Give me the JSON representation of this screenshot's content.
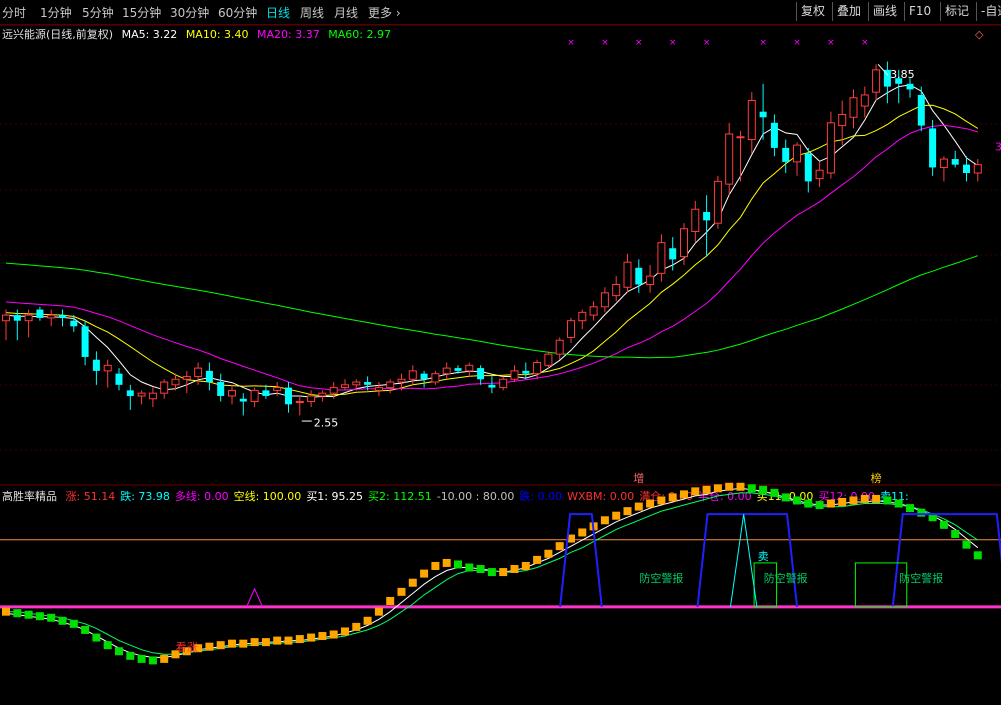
{
  "toolbar": {
    "periods": [
      "分时",
      "1分钟",
      "5分钟",
      "15分钟",
      "30分钟",
      "60分钟",
      "日线",
      "周线",
      "月线",
      "更多"
    ],
    "active_period": "日线",
    "more_arrow": "›",
    "right_buttons": [
      "复权",
      "叠加",
      "画线",
      "F10",
      "标记",
      "-自选"
    ]
  },
  "main_legend": {
    "stock_name": "远兴能源(日线,前复权)",
    "items": [
      {
        "label": "MA5: 3.22",
        "color": "#ffffff"
      },
      {
        "label": "MA10: 3.40",
        "color": "#ffff00"
      },
      {
        "label": "MA20: 3.37",
        "color": "#ff00ff"
      },
      {
        "label": "MA60: 2.97",
        "color": "#00ff00"
      }
    ]
  },
  "indicator_legend": {
    "name": "高胜率精品",
    "items": [
      {
        "label": "涨: 51.14",
        "color": "#ff3030"
      },
      {
        "label": "跌: 73.98",
        "color": "#00ffff"
      },
      {
        "label": "多线: 0.00",
        "color": "#ff00ff"
      },
      {
        "label": "空线: 100.00",
        "color": "#ffff00"
      },
      {
        "label": "买1: 95.25",
        "color": "#ffffff"
      },
      {
        "label": "买2: 112.51",
        "color": "#00ff00"
      },
      {
        "label": "-10.00 : 80.00",
        "color": "#c0c0c0"
      },
      {
        "label": "跌: 0.00",
        "color": "#0000ff"
      },
      {
        "label": "WXBM: 0.00",
        "color": "#ff3030"
      },
      {
        "label": "满仓: 0.00",
        "color": "#ff3030"
      },
      {
        "label": "半仓: 0.00",
        "color": "#ff00ff"
      },
      {
        "label": "买11: 0.00",
        "color": "#ffff00"
      },
      {
        "label": "买12: 0.00",
        "color": "#ff00ff"
      },
      {
        "label": "卖11:",
        "color": "#00ffff"
      }
    ]
  },
  "annotations": {
    "high_label": "3.85",
    "low_label": "2.55",
    "right_edge_label": "3",
    "top_marker": "◇",
    "marker_zeng": "增",
    "marker_bang": "榜",
    "signal_kanzhang": "看涨",
    "signal_fangkong": "防空警报",
    "signal_mai": "卖"
  },
  "chart_data": [
    {
      "type": "candlestick",
      "title": "远兴能源(日线,前复权)",
      "ylim": [
        2.4,
        3.95
      ],
      "candles": [
        [
          2.95,
          2.99,
          2.88,
          2.97
        ],
        [
          2.97,
          2.99,
          2.88,
          2.95
        ],
        [
          2.95,
          2.99,
          2.89,
          2.97
        ],
        [
          2.99,
          3.0,
          2.95,
          2.96
        ],
        [
          2.96,
          2.99,
          2.93,
          2.97
        ],
        [
          2.97,
          2.99,
          2.93,
          2.96
        ],
        [
          2.95,
          2.97,
          2.91,
          2.93
        ],
        [
          2.93,
          2.95,
          2.79,
          2.82
        ],
        [
          2.81,
          2.84,
          2.72,
          2.77
        ],
        [
          2.77,
          2.81,
          2.71,
          2.79
        ],
        [
          2.76,
          2.78,
          2.7,
          2.72
        ],
        [
          2.7,
          2.72,
          2.63,
          2.68
        ],
        [
          2.68,
          2.7,
          2.65,
          2.69
        ],
        [
          2.67,
          2.71,
          2.64,
          2.69
        ],
        [
          2.69,
          2.74,
          2.67,
          2.73
        ],
        [
          2.72,
          2.76,
          2.7,
          2.74
        ],
        [
          2.74,
          2.77,
          2.69,
          2.75
        ],
        [
          2.75,
          2.8,
          2.72,
          2.78
        ],
        [
          2.77,
          2.8,
          2.7,
          2.73
        ],
        [
          2.73,
          2.76,
          2.66,
          2.68
        ],
        [
          2.68,
          2.72,
          2.65,
          2.7
        ],
        [
          2.67,
          2.69,
          2.61,
          2.66
        ],
        [
          2.66,
          2.71,
          2.64,
          2.7
        ],
        [
          2.7,
          2.72,
          2.67,
          2.68
        ],
        [
          2.7,
          2.73,
          2.68,
          2.71
        ],
        [
          2.71,
          2.73,
          2.62,
          2.65
        ],
        [
          2.66,
          2.68,
          2.61,
          2.66
        ],
        [
          2.66,
          2.7,
          2.64,
          2.68
        ],
        [
          2.68,
          2.7,
          2.66,
          2.69
        ],
        [
          2.69,
          2.73,
          2.67,
          2.71
        ],
        [
          2.71,
          2.74,
          2.7,
          2.72
        ],
        [
          2.72,
          2.74,
          2.7,
          2.73
        ],
        [
          2.73,
          2.75,
          2.7,
          2.72
        ],
        [
          2.7,
          2.73,
          2.68,
          2.71
        ],
        [
          2.71,
          2.74,
          2.69,
          2.73
        ],
        [
          2.73,
          2.76,
          2.7,
          2.74
        ],
        [
          2.74,
          2.79,
          2.72,
          2.77
        ],
        [
          2.76,
          2.77,
          2.71,
          2.74
        ],
        [
          2.73,
          2.77,
          2.72,
          2.76
        ],
        [
          2.76,
          2.8,
          2.74,
          2.78
        ],
        [
          2.78,
          2.79,
          2.76,
          2.77
        ],
        [
          2.77,
          2.8,
          2.75,
          2.79
        ],
        [
          2.78,
          2.79,
          2.72,
          2.74
        ],
        [
          2.72,
          2.75,
          2.69,
          2.71
        ],
        [
          2.71,
          2.75,
          2.7,
          2.74
        ],
        [
          2.74,
          2.79,
          2.73,
          2.77
        ],
        [
          2.77,
          2.8,
          2.74,
          2.76
        ],
        [
          2.76,
          2.81,
          2.74,
          2.8
        ],
        [
          2.79,
          2.84,
          2.78,
          2.83
        ],
        [
          2.83,
          2.89,
          2.81,
          2.88
        ],
        [
          2.89,
          2.96,
          2.87,
          2.95
        ],
        [
          2.95,
          2.99,
          2.92,
          2.98
        ],
        [
          2.97,
          3.02,
          2.95,
          3.0
        ],
        [
          3.0,
          3.07,
          2.98,
          3.05
        ],
        [
          3.04,
          3.11,
          3.02,
          3.08
        ],
        [
          3.07,
          3.19,
          3.05,
          3.16
        ],
        [
          3.14,
          3.17,
          3.05,
          3.08
        ],
        [
          3.08,
          3.15,
          3.05,
          3.11
        ],
        [
          3.12,
          3.26,
          3.09,
          3.23
        ],
        [
          3.21,
          3.25,
          3.13,
          3.17
        ],
        [
          3.18,
          3.3,
          3.15,
          3.28
        ],
        [
          3.27,
          3.38,
          3.23,
          3.35
        ],
        [
          3.34,
          3.4,
          3.18,
          3.31
        ],
        [
          3.3,
          3.47,
          3.28,
          3.45
        ],
        [
          3.44,
          3.66,
          3.4,
          3.62
        ],
        [
          3.61,
          3.63,
          3.45,
          3.61
        ],
        [
          3.6,
          3.77,
          3.55,
          3.74
        ],
        [
          3.7,
          3.8,
          3.6,
          3.68
        ],
        [
          3.66,
          3.69,
          3.54,
          3.57
        ],
        [
          3.57,
          3.6,
          3.48,
          3.52
        ],
        [
          3.52,
          3.59,
          3.47,
          3.58
        ],
        [
          3.55,
          3.57,
          3.41,
          3.45
        ],
        [
          3.46,
          3.52,
          3.43,
          3.49
        ],
        [
          3.48,
          3.7,
          3.46,
          3.66
        ],
        [
          3.65,
          3.74,
          3.58,
          3.69
        ],
        [
          3.68,
          3.78,
          3.64,
          3.75
        ],
        [
          3.72,
          3.79,
          3.68,
          3.76
        ],
        [
          3.77,
          3.87,
          3.74,
          3.85
        ],
        [
          3.85,
          3.88,
          3.73,
          3.79
        ],
        [
          3.82,
          3.85,
          3.73,
          3.8
        ],
        [
          3.8,
          3.82,
          3.75,
          3.78
        ],
        [
          3.76,
          3.79,
          3.63,
          3.65
        ],
        [
          3.64,
          3.67,
          3.47,
          3.5
        ],
        [
          3.5,
          3.54,
          3.45,
          3.53
        ],
        [
          3.53,
          3.56,
          3.5,
          3.51
        ],
        [
          3.51,
          3.54,
          3.45,
          3.48
        ],
        [
          3.48,
          3.53,
          3.45,
          3.51
        ]
      ],
      "series": [
        {
          "name": "MA5",
          "color": "#ffffff"
        },
        {
          "name": "MA10",
          "color": "#ffff00"
        },
        {
          "name": "MA20",
          "color": "#ff00ff"
        },
        {
          "name": "MA60",
          "color": "#00ff00"
        }
      ]
    },
    {
      "type": "line",
      "title": "高胜率精品",
      "ylim": [
        -10,
        120
      ],
      "reference_lines": [
        95.25,
        51.14
      ],
      "step_values": [
        48,
        47,
        46,
        45,
        44,
        42,
        40,
        36,
        31,
        26,
        22,
        19,
        17,
        16,
        17,
        20,
        22,
        24,
        25,
        26,
        27,
        27,
        28,
        28,
        29,
        29,
        30,
        31,
        32,
        33,
        35,
        38,
        42,
        48,
        55,
        61,
        67,
        73,
        78,
        80,
        79,
        77,
        76,
        74,
        74,
        76,
        78,
        82,
        86,
        91,
        96,
        100,
        104,
        108,
        111,
        114,
        117,
        119,
        121,
        123,
        125,
        127,
        128,
        129,
        130,
        130,
        129,
        128,
        126,
        123,
        121,
        119,
        118,
        119,
        120,
        121,
        122,
        122,
        121,
        119,
        116,
        113,
        110,
        105,
        99,
        92,
        85
      ],
      "white_line": [
        47,
        46,
        45,
        44,
        43,
        41,
        39,
        36,
        32,
        28,
        24,
        21,
        19,
        18,
        18,
        19,
        21,
        23,
        24,
        25,
        26,
        27,
        27,
        28,
        28,
        29,
        29,
        30,
        31,
        32,
        34,
        36,
        39,
        43,
        48,
        54,
        60,
        66,
        71,
        75,
        77,
        77,
        76,
        75,
        74,
        75,
        77,
        80,
        83,
        87,
        91,
        95,
        99,
        103,
        107,
        110,
        113,
        116,
        118,
        120,
        122,
        124,
        125,
        127,
        128,
        129,
        128,
        127,
        125,
        123,
        121,
        119,
        118,
        118,
        119,
        120,
        120,
        121,
        120,
        119,
        117,
        114,
        111,
        107,
        102,
        96,
        90
      ],
      "green_line": [
        48,
        48,
        47,
        46,
        45,
        44,
        42,
        40,
        37,
        33,
        29,
        26,
        23,
        21,
        20,
        20,
        21,
        22,
        23,
        24,
        25,
        26,
        26,
        27,
        27,
        28,
        28,
        29,
        30,
        31,
        32,
        34,
        36,
        39,
        43,
        48,
        53,
        59,
        64,
        69,
        73,
        75,
        75,
        75,
        74,
        74,
        75,
        77,
        80,
        83,
        87,
        90,
        94,
        98,
        102,
        105,
        108,
        111,
        114,
        116,
        118,
        120,
        122,
        124,
        125,
        126,
        126,
        125,
        124,
        122,
        120,
        118,
        117,
        117,
        117,
        118,
        119,
        119,
        119,
        118,
        117,
        115,
        112,
        109,
        105,
        100,
        95
      ],
      "kanzhang_at": 22,
      "fangkong_windows": [
        [
          78,
          81
        ],
        [
          97,
          108
        ],
        [
          124,
          137
        ]
      ],
      "fangkong_boxes": [
        [
          104,
          106
        ],
        [
          118,
          124
        ]
      ],
      "mai_spike": [
        101,
        103
      ]
    }
  ]
}
